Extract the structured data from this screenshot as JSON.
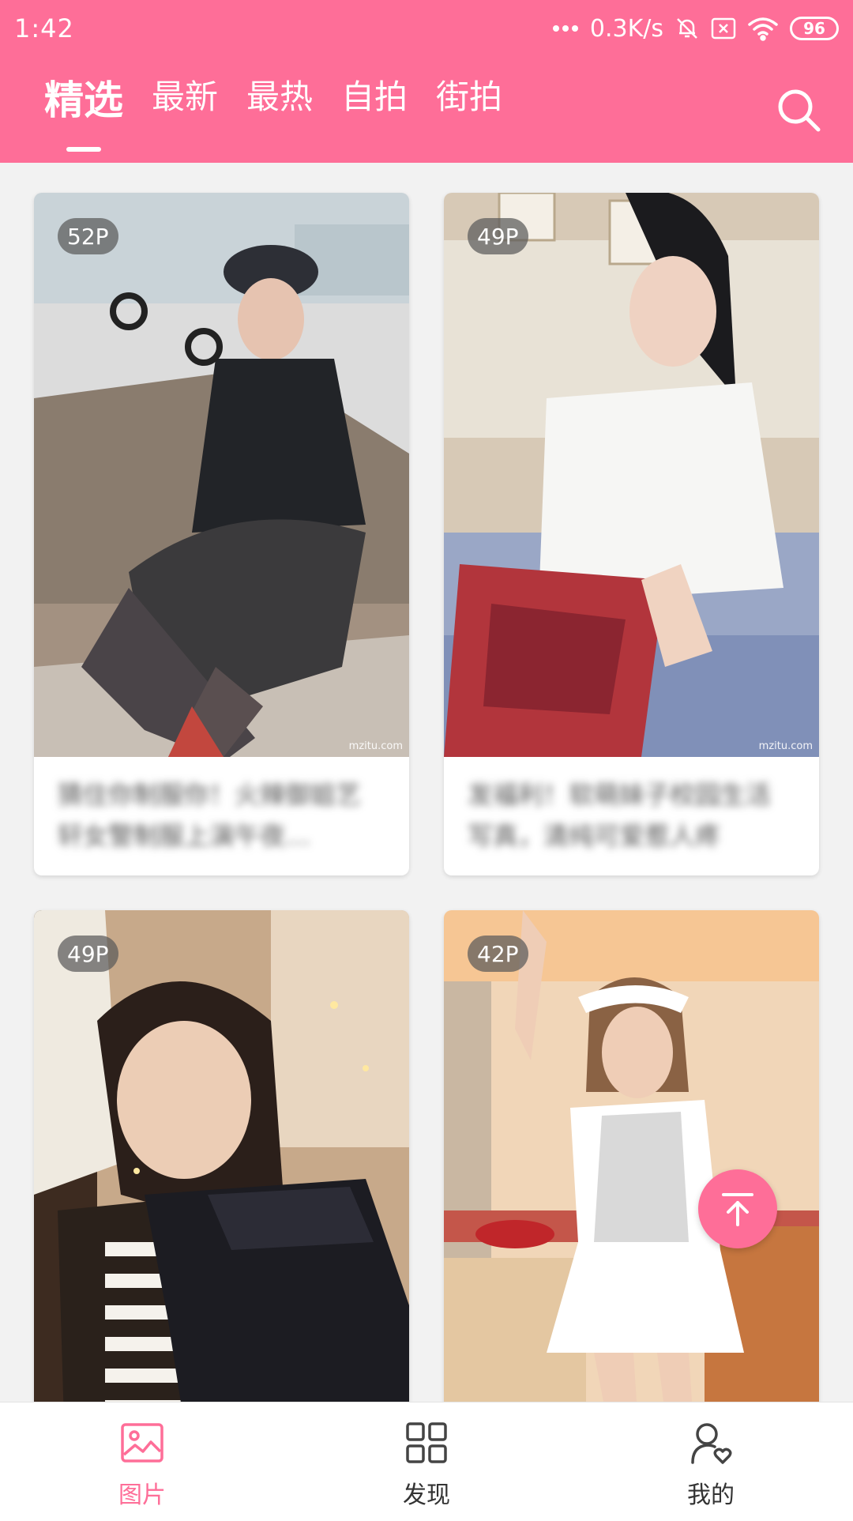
{
  "status_bar": {
    "time": "1:42",
    "network_speed": "0.3K/s",
    "battery_level": "96",
    "icons": [
      "more-dots-icon",
      "mute-bell-icon",
      "sim-x-icon",
      "wifi-icon",
      "battery-icon"
    ]
  },
  "header": {
    "tabs": [
      {
        "label": "精选",
        "active": true
      },
      {
        "label": "最新",
        "active": false
      },
      {
        "label": "最热",
        "active": false
      },
      {
        "label": "自拍",
        "active": false
      },
      {
        "label": "街拍",
        "active": false
      }
    ],
    "search_icon": "search-icon",
    "accent_color": "#fe6e98"
  },
  "feed": {
    "cards": [
      {
        "count_badge": "52P",
        "title": "猜住你制服你！火辣御姐艺轩女警制服上演午夜…",
        "watermark": "mzitu.com"
      },
      {
        "count_badge": "49P",
        "title": "发福利！软萌妹子校园生活写真，清纯可爱惹人疼",
        "watermark": "mzitu.com"
      },
      {
        "count_badge": "49P",
        "title": "",
        "watermark": ""
      },
      {
        "count_badge": "42P",
        "title": "",
        "watermark": ""
      }
    ]
  },
  "fab": {
    "icon": "arrow-up-to-top-icon"
  },
  "bottom_nav": {
    "items": [
      {
        "label": "图片",
        "icon": "image-icon",
        "active": true
      },
      {
        "label": "发现",
        "icon": "grid-icon",
        "active": false
      },
      {
        "label": "我的",
        "icon": "user-heart-icon",
        "active": false
      }
    ]
  }
}
